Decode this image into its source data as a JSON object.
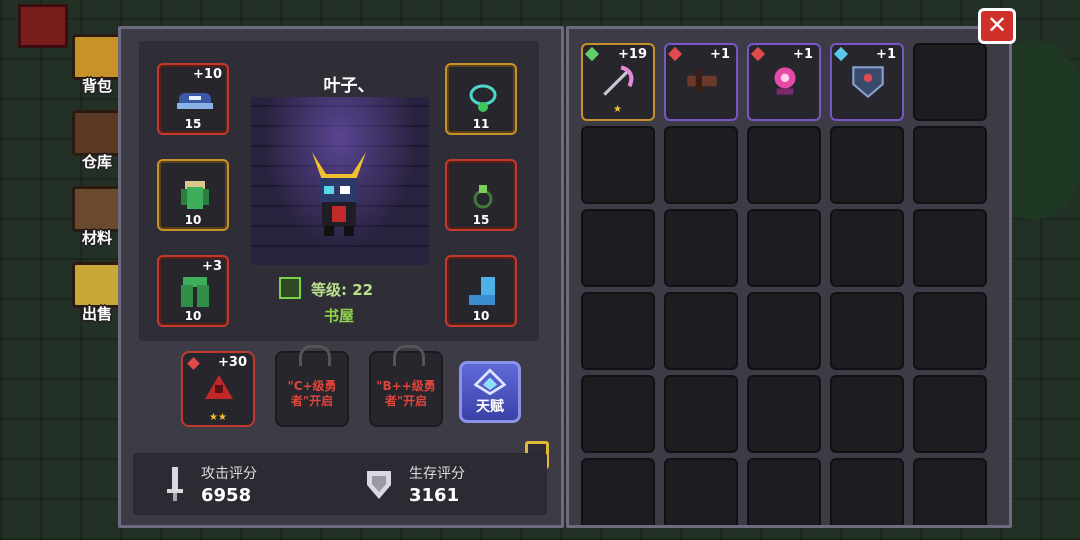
{
  "side_tabs": [
    {
      "label": "背包",
      "icon": "backpack-icon",
      "active": true
    },
    {
      "label": "仓库",
      "icon": "warehouse-icon",
      "active": false
    },
    {
      "label": "材料",
      "icon": "materials-icon",
      "active": false
    },
    {
      "label": "出售",
      "icon": "gold-pile-icon",
      "active": false
    }
  ],
  "character": {
    "name": "叶子、",
    "level_label": "等级: 22",
    "location": "书屋"
  },
  "equipment": {
    "helmet": {
      "plus": "+10",
      "level": "15",
      "icon": "helmet-icon",
      "rarity": "red"
    },
    "necklace": {
      "plus": "",
      "level": "11",
      "icon": "necklace-icon",
      "rarity": "gold"
    },
    "armor": {
      "plus": "",
      "level": "10",
      "icon": "armor-icon",
      "rarity": "gold"
    },
    "ring": {
      "plus": "",
      "level": "15",
      "icon": "ring-icon",
      "rarity": "red"
    },
    "pants": {
      "plus": "+3",
      "level": "10",
      "icon": "pants-icon",
      "rarity": "red"
    },
    "boots": {
      "plus": "",
      "level": "10",
      "icon": "boots-icon",
      "rarity": "red"
    }
  },
  "pet_slot": {
    "plus": "+30",
    "stars": "★★",
    "icon": "pet-icon"
  },
  "locked_slots": [
    {
      "text": "\"C+级勇者\"开启"
    },
    {
      "text": "\"B++级勇者\"开启"
    }
  ],
  "talent": {
    "label": "天赋"
  },
  "stats": {
    "attack_label": "攻击评分",
    "attack_value": "6958",
    "survival_label": "生存评分",
    "survival_value": "3161"
  },
  "inventory": [
    {
      "plus": "+19",
      "rarity": "gold",
      "gem": "#5fd06a",
      "icon": "scythe-icon",
      "stars": "★"
    },
    {
      "plus": "+1",
      "rarity": "purple",
      "gem": "#e04a4a",
      "icon": "crossbow-icon",
      "stars": ""
    },
    {
      "plus": "+1",
      "rarity": "purple",
      "gem": "#e04a4a",
      "icon": "flower-icon",
      "stars": ""
    },
    {
      "plus": "+1",
      "rarity": "purple",
      "gem": "#5ac8e8",
      "icon": "shield-icon",
      "stars": ""
    }
  ],
  "colors": {
    "plus_text": "#ffffff",
    "level_text": "#ffffff",
    "accent_red": "#c03a2e",
    "accent_gold": "#c8922a",
    "accent_purple": "#7a55c8"
  }
}
